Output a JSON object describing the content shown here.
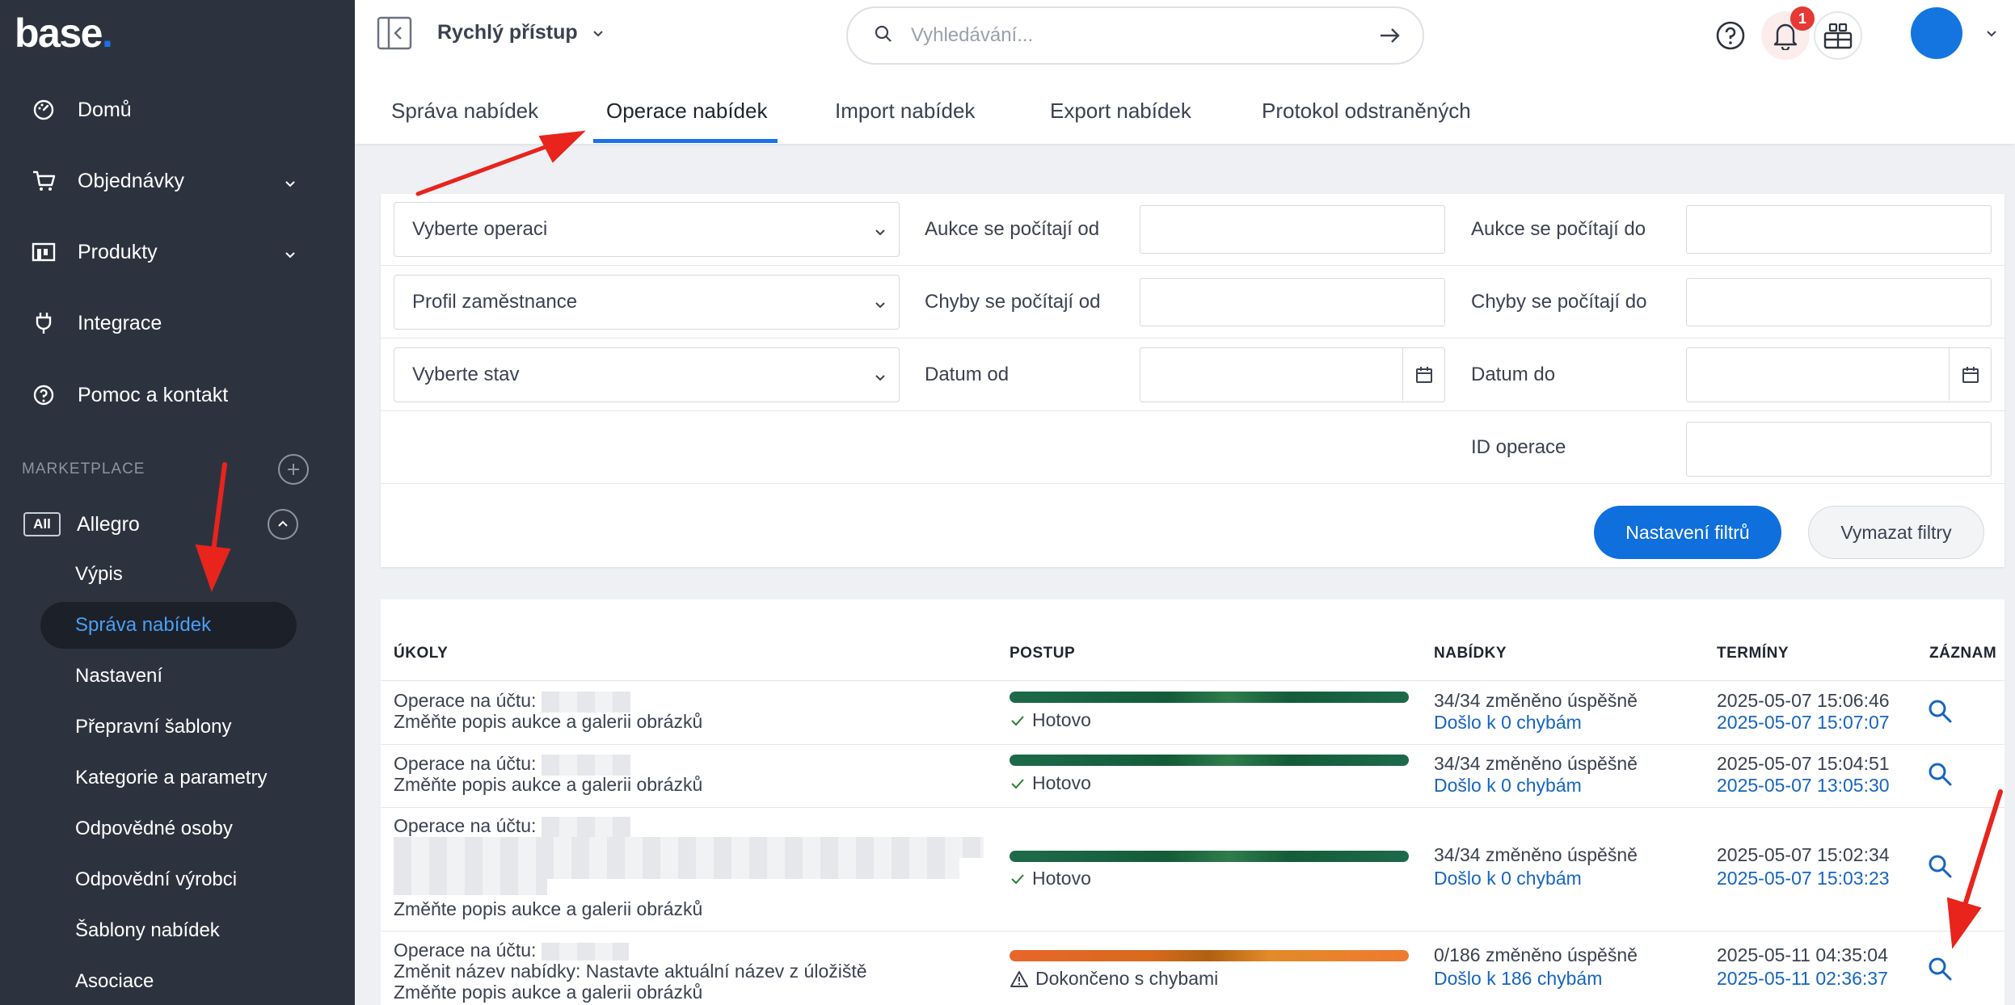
{
  "app": {
    "logo_text": "base",
    "logo_dot": "."
  },
  "sidebar": {
    "items": [
      {
        "label": "Domů",
        "icon": "dashboard-icon"
      },
      {
        "label": "Objednávky",
        "icon": "cart-icon"
      },
      {
        "label": "Produkty",
        "icon": "products-icon"
      },
      {
        "label": "Integrace",
        "icon": "plug-icon"
      },
      {
        "label": "Pomoc a kontakt",
        "icon": "help-icon"
      }
    ],
    "section_label": "MARKETPLACE",
    "allegro": {
      "badge": "All",
      "label": "Allegro"
    },
    "sub_items": [
      {
        "label": "Výpis"
      },
      {
        "label": "Správa nabídek"
      },
      {
        "label": "Nastavení"
      },
      {
        "label": "Přepravní šablony"
      },
      {
        "label": "Kategorie a parametry"
      },
      {
        "label": "Odpovědné osoby"
      },
      {
        "label": "Odpovědní výrobci"
      },
      {
        "label": "Šablony nabídek"
      },
      {
        "label": "Asociace"
      }
    ]
  },
  "topbar": {
    "quick_access": "Rychlý přístup",
    "search_placeholder": "Vyhledávání...",
    "notification_count": "1"
  },
  "tabs": [
    {
      "label": "Správa nabídek"
    },
    {
      "label": "Operace nabídek"
    },
    {
      "label": "Import nabídek"
    },
    {
      "label": "Export nabídek"
    },
    {
      "label": "Protokol odstraněných"
    }
  ],
  "filters": {
    "select_operation": "Vyberte operaci",
    "select_employee": "Profil zaměstnance",
    "select_status": "Vyberte stav",
    "auctions_from": "Aukce se počítají od",
    "auctions_to": "Aukce se počítají do",
    "errors_from": "Chyby se počítají od",
    "errors_to": "Chyby se počítají do",
    "date_from": "Datum od",
    "date_to": "Datum do",
    "operation_id": "ID operace",
    "apply_button": "Nastavení filtrů",
    "clear_button": "Vymazat filtry"
  },
  "table": {
    "headers": {
      "tasks": "ÚKOLY",
      "progress": "POSTUP",
      "offers": "NABÍDKY",
      "dates": "TERMÍNY",
      "record": "ZÁZNAM"
    },
    "rows": [
      {
        "task_line1": "Operace na účtu:",
        "task_line2": "Změňte popis aukce a galerii obrázků",
        "progress": 1.0,
        "status": "Hotovo",
        "offers_ok": "34/34 změněno úspěšně",
        "offers_err": "Došlo k 0 chybám",
        "date_start": "2025-05-07 15:06:46",
        "date_end": "2025-05-07 15:07:07"
      },
      {
        "task_line1": "Operace na účtu:",
        "task_line2": "Změňte popis aukce a galerii obrázků",
        "progress": 1.0,
        "status": "Hotovo",
        "offers_ok": "34/34 změněno úspěšně",
        "offers_err": "Došlo k 0 chybám",
        "date_start": "2025-05-07 15:04:51",
        "date_end": "2025-05-07 13:05:30"
      },
      {
        "task_line1": "Operace na účtu:",
        "task_line2": "Změňte popis aukce a galerii obrázků",
        "progress": 1.0,
        "status": "Hotovo",
        "offers_ok": "34/34 změněno úspěšně",
        "offers_err": "Došlo k 0 chybám",
        "date_start": "2025-05-07 15:02:34",
        "date_end": "2025-05-07 15:03:23"
      },
      {
        "task_line1": "Operace na účtu:",
        "task_line2": "Změnit název nabídky: Nastavte aktuální název z úložiště",
        "task_line3": "Změňte popis aukce a galerii obrázků",
        "progress": 1.0,
        "status": "Dokončeno s chybami",
        "offers_ok": "0/186 změněno úspěšně",
        "offers_err": "Došlo k 186 chybám",
        "date_start": "2025-05-11 04:35:04",
        "date_end": "2025-05-11 02:36:37"
      }
    ]
  },
  "colors": {
    "sidebar_bg": "#2d333e",
    "accent": "#1a73e8",
    "progress_done": "#145c3a",
    "progress_errors": "#e8662a",
    "annotation_arrow": "#e8241c"
  }
}
